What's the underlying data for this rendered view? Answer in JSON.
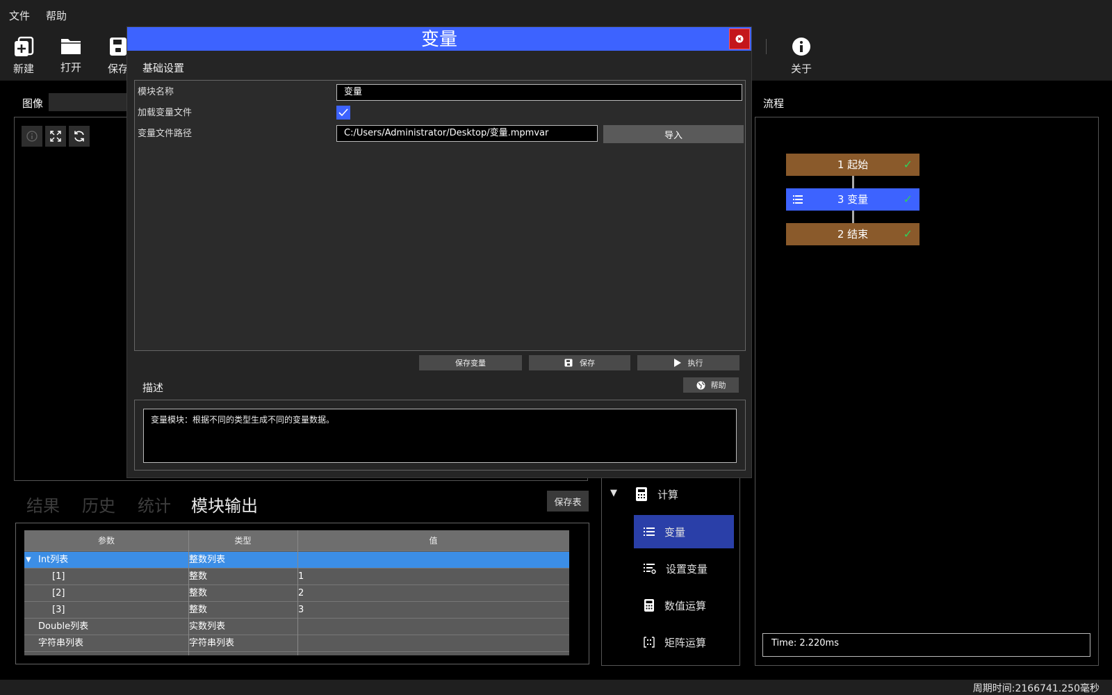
{
  "menu": {
    "file": "文件",
    "help": "帮助"
  },
  "toolbar": {
    "new": "新建",
    "open": "打开",
    "save": "保存",
    "about": "关于"
  },
  "image_panel": {
    "title": "图像"
  },
  "tabs": {
    "result": "结果",
    "history": "历史",
    "stats": "统计",
    "module_output": "模块输出"
  },
  "save_table": "保存表",
  "table": {
    "headers": [
      "参数",
      "类型",
      "值"
    ],
    "rows": [
      {
        "param": "Int列表",
        "type": "整数列表",
        "value": "",
        "expander": "▼"
      },
      {
        "param": "[1]",
        "type": "整数",
        "value": "1"
      },
      {
        "param": "[2]",
        "type": "整数",
        "value": "2"
      },
      {
        "param": "[3]",
        "type": "整数",
        "value": "3"
      },
      {
        "param": "Double列表",
        "type": "实数列表",
        "value": ""
      },
      {
        "param": "字符串列表",
        "type": "字符串列表",
        "value": ""
      }
    ]
  },
  "tree": {
    "group": "计算",
    "group_arrow": "▼",
    "items": [
      "变量",
      "设置变量",
      "数值运算",
      "矩阵运算"
    ]
  },
  "flow": {
    "title": "流程",
    "nodes": [
      {
        "label": "1 起始",
        "check": "✓"
      },
      {
        "label": "3 变量",
        "check": "✓"
      },
      {
        "label": "2 结束",
        "check": "✓"
      }
    ],
    "time": "Time: 2.220ms"
  },
  "status": {
    "cycle_time": "周期时间:2166741.250毫秒"
  },
  "dialog": {
    "title": "变量",
    "basic_settings": "基础设置",
    "module_name_label": "模块名称",
    "module_name_value": "变量",
    "load_file_label": "加载变量文件",
    "load_file_checked": true,
    "file_path_label": "变量文件路径",
    "file_path_value": "C:/Users/Administrator/Desktop/变量.mpmvar",
    "import": "导入",
    "save_vars": "保存变量",
    "save": "保存",
    "execute": "执行",
    "description_title": "描述",
    "help": "帮助",
    "description_text": "变量模块：根据不同的类型生成不同的变量数据。"
  },
  "colors": {
    "accent_blue": "#3d63ff",
    "close_red": "#c4161c",
    "flow_node_brown": "#8a5a2b",
    "table_selected": "#3c8ee6",
    "check_green": "#2fd05a"
  }
}
